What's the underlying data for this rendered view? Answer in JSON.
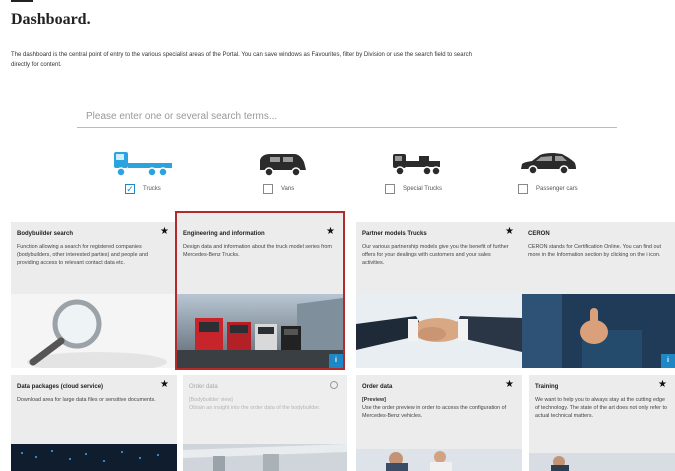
{
  "page": {
    "title": "Dashboard.",
    "intro": "The dashboard is the central point of entry to the various specialist areas of the Portal. You can save windows as Favourites, filter by Division or use the search field to search directly for content."
  },
  "search": {
    "placeholder": "Please enter one or several search terms..."
  },
  "filters": [
    {
      "label": "Trucks",
      "checked": true,
      "icon": "truck-icon"
    },
    {
      "label": "Vans",
      "checked": false,
      "icon": "van-icon"
    },
    {
      "label": "Special Trucks",
      "checked": false,
      "icon": "special-truck-icon"
    },
    {
      "label": "Passenger cars",
      "checked": false,
      "icon": "passenger-car-icon"
    }
  ],
  "cards": [
    {
      "title": "Bodybuilder search",
      "desc": "Function allowing a search for registered companies (bodybuilders, other interested parties) and people and providing access to relevant contact data etc.",
      "icon": "star-icon",
      "image": "magnifier-image"
    },
    {
      "title": "Engineering and information",
      "desc": "Design data and information about the truck model series from Mercedes-Benz Trucks.",
      "icon": "star-icon",
      "image": "trucks-image",
      "selected": true,
      "info_badge": "i"
    },
    {
      "title": "Partner models Trucks",
      "desc": "Our various partnership models give you the benefit of further offers for your dealings with customers and your sales activities.",
      "icon": "star-icon",
      "image": "handshake-image"
    },
    {
      "title": "CERON",
      "desc": "CERON stands for Certification Online. You can find out more in the Information section by clicking on the i icon.",
      "icon": "star-icon",
      "image": "thumbs-up-image",
      "info_badge": "i"
    },
    {
      "title": "Data packages (cloud service)",
      "desc": "Download area for large data files or sensitive documents.",
      "icon": "star-icon",
      "image": "data-image"
    },
    {
      "title": "Order data",
      "subtitle": "[Bodybuilder view]",
      "desc": "Obtain an insight into the order data of the bodybuilder.",
      "icon": "lock-icon",
      "image": "factory-image",
      "disabled": true
    },
    {
      "title": "Order data",
      "subtitle": "[Preview]",
      "desc": "Use the order preview in order to access the configuration of Mercedes-Benz vehicles.",
      "icon": "star-icon",
      "image": "people-image"
    },
    {
      "title": "Training",
      "desc": "We want to help you to always stay at the cutting edge of technology. The state of the art does not only refer to actual technical matters.",
      "icon": "star-icon",
      "image": "training-image"
    }
  ],
  "colors": {
    "accent": "#1e88c7",
    "selection": "#b22a2a",
    "card_bg": "#ececec"
  }
}
